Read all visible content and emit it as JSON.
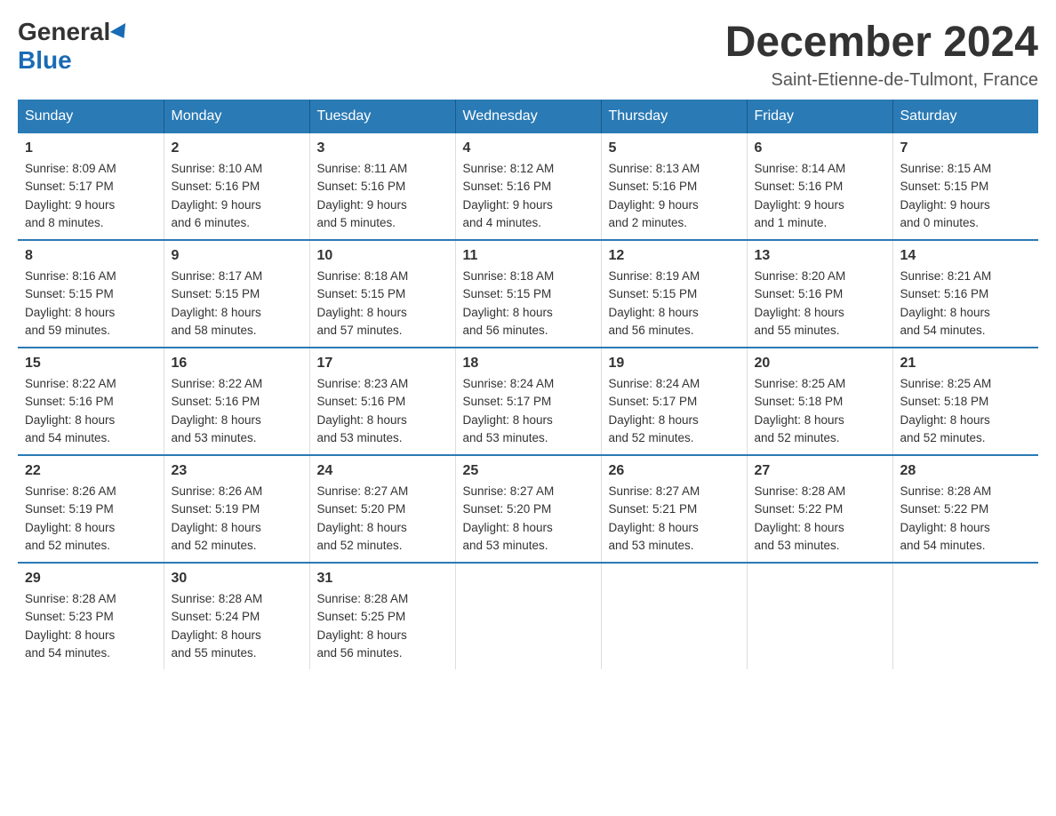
{
  "logo": {
    "general": "General",
    "blue": "Blue"
  },
  "title": "December 2024",
  "location": "Saint-Etienne-de-Tulmont, France",
  "days_of_week": [
    "Sunday",
    "Monday",
    "Tuesday",
    "Wednesday",
    "Thursday",
    "Friday",
    "Saturday"
  ],
  "weeks": [
    [
      {
        "day": "1",
        "sunrise": "8:09 AM",
        "sunset": "5:17 PM",
        "daylight": "9 hours and 8 minutes."
      },
      {
        "day": "2",
        "sunrise": "8:10 AM",
        "sunset": "5:16 PM",
        "daylight": "9 hours and 6 minutes."
      },
      {
        "day": "3",
        "sunrise": "8:11 AM",
        "sunset": "5:16 PM",
        "daylight": "9 hours and 5 minutes."
      },
      {
        "day": "4",
        "sunrise": "8:12 AM",
        "sunset": "5:16 PM",
        "daylight": "9 hours and 4 minutes."
      },
      {
        "day": "5",
        "sunrise": "8:13 AM",
        "sunset": "5:16 PM",
        "daylight": "9 hours and 2 minutes."
      },
      {
        "day": "6",
        "sunrise": "8:14 AM",
        "sunset": "5:16 PM",
        "daylight": "9 hours and 1 minute."
      },
      {
        "day": "7",
        "sunrise": "8:15 AM",
        "sunset": "5:15 PM",
        "daylight": "9 hours and 0 minutes."
      }
    ],
    [
      {
        "day": "8",
        "sunrise": "8:16 AM",
        "sunset": "5:15 PM",
        "daylight": "8 hours and 59 minutes."
      },
      {
        "day": "9",
        "sunrise": "8:17 AM",
        "sunset": "5:15 PM",
        "daylight": "8 hours and 58 minutes."
      },
      {
        "day": "10",
        "sunrise": "8:18 AM",
        "sunset": "5:15 PM",
        "daylight": "8 hours and 57 minutes."
      },
      {
        "day": "11",
        "sunrise": "8:18 AM",
        "sunset": "5:15 PM",
        "daylight": "8 hours and 56 minutes."
      },
      {
        "day": "12",
        "sunrise": "8:19 AM",
        "sunset": "5:15 PM",
        "daylight": "8 hours and 56 minutes."
      },
      {
        "day": "13",
        "sunrise": "8:20 AM",
        "sunset": "5:16 PM",
        "daylight": "8 hours and 55 minutes."
      },
      {
        "day": "14",
        "sunrise": "8:21 AM",
        "sunset": "5:16 PM",
        "daylight": "8 hours and 54 minutes."
      }
    ],
    [
      {
        "day": "15",
        "sunrise": "8:22 AM",
        "sunset": "5:16 PM",
        "daylight": "8 hours and 54 minutes."
      },
      {
        "day": "16",
        "sunrise": "8:22 AM",
        "sunset": "5:16 PM",
        "daylight": "8 hours and 53 minutes."
      },
      {
        "day": "17",
        "sunrise": "8:23 AM",
        "sunset": "5:16 PM",
        "daylight": "8 hours and 53 minutes."
      },
      {
        "day": "18",
        "sunrise": "8:24 AM",
        "sunset": "5:17 PM",
        "daylight": "8 hours and 53 minutes."
      },
      {
        "day": "19",
        "sunrise": "8:24 AM",
        "sunset": "5:17 PM",
        "daylight": "8 hours and 52 minutes."
      },
      {
        "day": "20",
        "sunrise": "8:25 AM",
        "sunset": "5:18 PM",
        "daylight": "8 hours and 52 minutes."
      },
      {
        "day": "21",
        "sunrise": "8:25 AM",
        "sunset": "5:18 PM",
        "daylight": "8 hours and 52 minutes."
      }
    ],
    [
      {
        "day": "22",
        "sunrise": "8:26 AM",
        "sunset": "5:19 PM",
        "daylight": "8 hours and 52 minutes."
      },
      {
        "day": "23",
        "sunrise": "8:26 AM",
        "sunset": "5:19 PM",
        "daylight": "8 hours and 52 minutes."
      },
      {
        "day": "24",
        "sunrise": "8:27 AM",
        "sunset": "5:20 PM",
        "daylight": "8 hours and 52 minutes."
      },
      {
        "day": "25",
        "sunrise": "8:27 AM",
        "sunset": "5:20 PM",
        "daylight": "8 hours and 53 minutes."
      },
      {
        "day": "26",
        "sunrise": "8:27 AM",
        "sunset": "5:21 PM",
        "daylight": "8 hours and 53 minutes."
      },
      {
        "day": "27",
        "sunrise": "8:28 AM",
        "sunset": "5:22 PM",
        "daylight": "8 hours and 53 minutes."
      },
      {
        "day": "28",
        "sunrise": "8:28 AM",
        "sunset": "5:22 PM",
        "daylight": "8 hours and 54 minutes."
      }
    ],
    [
      {
        "day": "29",
        "sunrise": "8:28 AM",
        "sunset": "5:23 PM",
        "daylight": "8 hours and 54 minutes."
      },
      {
        "day": "30",
        "sunrise": "8:28 AM",
        "sunset": "5:24 PM",
        "daylight": "8 hours and 55 minutes."
      },
      {
        "day": "31",
        "sunrise": "8:28 AM",
        "sunset": "5:25 PM",
        "daylight": "8 hours and 56 minutes."
      },
      null,
      null,
      null,
      null
    ]
  ],
  "labels": {
    "sunrise": "Sunrise:",
    "sunset": "Sunset:",
    "daylight": "Daylight:"
  }
}
